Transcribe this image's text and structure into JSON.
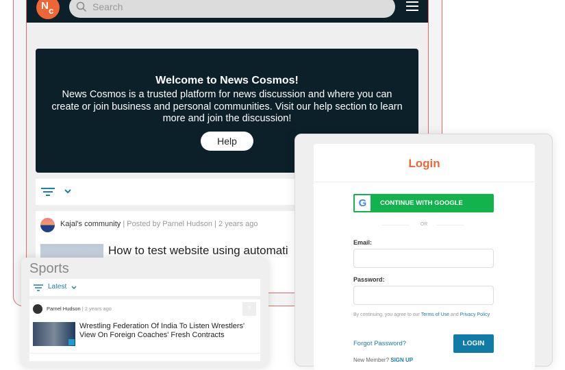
{
  "header": {
    "logo_text": "NC",
    "search_placeholder": "Search"
  },
  "banner": {
    "title": "Welcome to News Cosmos!",
    "text": "News Cosmos is a trusted platform for news discussion and where you can create or join business and personal communities. Visit our help section to learn more and join the discussion!",
    "help_label": "Help"
  },
  "post": {
    "community": "Kajal's community",
    "posted_by": "Posted by Parnel Hudson",
    "time": "2 years ago",
    "title": "How to test website using automati"
  },
  "sports": {
    "title": "Sports",
    "sort": "Latest",
    "author": "Parnel Hudson",
    "time": "2 years ago",
    "badge": "?",
    "headline": "Wrestling Federation Of India To Listen Wrestlers' View On Foreign Coaches' Fresh Contracts"
  },
  "login": {
    "title": "Login",
    "google_label": "CONTINUE WITH GOOGLE",
    "or": "OR",
    "email_label": "Email:",
    "password_label": "Password:",
    "terms_prefix": "By continuing, you agree to our",
    "terms_link": "Terms of Use",
    "terms_and": "and",
    "privacy_link": "Privacy Policy",
    "forgot": "Forgot Password?",
    "login_button": "LOGIN",
    "new_member": "New Member?",
    "signup": "SIGN UP"
  },
  "colors": {
    "brand": "#ee6636",
    "dark": "#0c2029",
    "google_green": "#12b24c",
    "login_blue": "#0f7ca8"
  }
}
